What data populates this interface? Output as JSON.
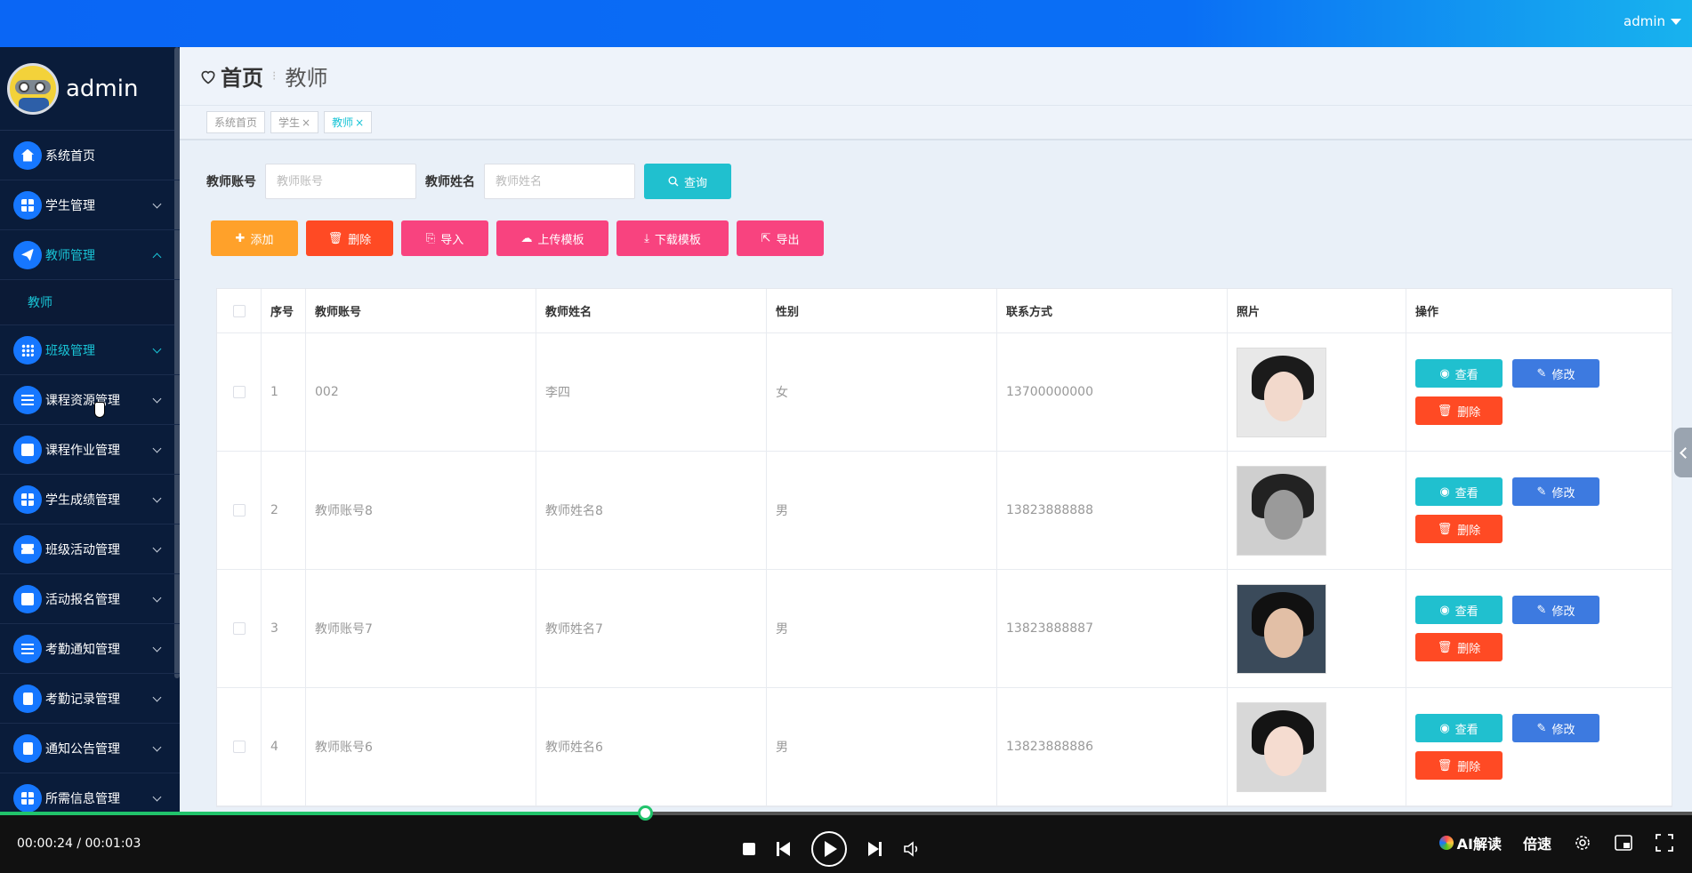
{
  "header": {
    "user": "admin"
  },
  "sidebar": {
    "username": "admin",
    "items": [
      {
        "label": "系统首页",
        "icon": "home-icon"
      },
      {
        "label": "学生管理",
        "icon": "grid-icon"
      },
      {
        "label": "教师管理",
        "icon": "paper-plane-icon"
      },
      {
        "label": "班级管理",
        "icon": "apps-icon"
      },
      {
        "label": "课程资源管理",
        "icon": "sliders-icon"
      },
      {
        "label": "课程作业管理",
        "icon": "book-icon"
      },
      {
        "label": "学生成绩管理",
        "icon": "grid-icon"
      },
      {
        "label": "班级活动管理",
        "icon": "ticket-icon"
      },
      {
        "label": "活动报名管理",
        "icon": "chart-icon"
      },
      {
        "label": "考勤通知管理",
        "icon": "list-icon"
      },
      {
        "label": "考勤记录管理",
        "icon": "clipboard-icon"
      },
      {
        "label": "通知公告管理",
        "icon": "check-icon"
      },
      {
        "label": "所需信息管理",
        "icon": "grid-icon"
      }
    ],
    "subitem": "教师"
  },
  "breadcrumb": {
    "home": "首页",
    "current": "教师"
  },
  "tabs": [
    {
      "label": "系统首页",
      "closable": ""
    },
    {
      "label": "学生",
      "closable": "×"
    },
    {
      "label": "教师",
      "closable": "×"
    }
  ],
  "search": {
    "account_label": "教师账号",
    "account_placeholder": "教师账号",
    "name_label": "教师姓名",
    "name_placeholder": "教师姓名",
    "query": "查询"
  },
  "actions": {
    "add": "添加",
    "delete": "删除",
    "import": "导入",
    "upload_template": "上传模板",
    "download_template": "下载模板",
    "export": "导出"
  },
  "colors": {
    "add": "#ffa12a",
    "delete": "#ff4a24",
    "import": "#f8437f",
    "upload": "#f8437f",
    "download": "#f8437f",
    "export": "#f8437f"
  },
  "table": {
    "headers": [
      "序号",
      "教师账号",
      "教师姓名",
      "性别",
      "联系方式",
      "照片",
      "操作"
    ],
    "rows": [
      {
        "index": "1",
        "account": "002",
        "name": "李四",
        "gender": "女",
        "phone": "13700000000"
      },
      {
        "index": "2",
        "account": "教师账号8",
        "name": "教师姓名8",
        "gender": "男",
        "phone": "13823888888"
      },
      {
        "index": "3",
        "account": "教师账号7",
        "name": "教师姓名7",
        "gender": "男",
        "phone": "13823888887"
      },
      {
        "index": "4",
        "account": "教师账号6",
        "name": "教师姓名6",
        "gender": "男",
        "phone": "13823888886"
      }
    ],
    "ops": {
      "view": "查看",
      "edit": "修改",
      "delete": "删除"
    }
  },
  "player": {
    "time": "00:00:24 / 00:01:03",
    "progress": 0.381,
    "ai": "AI解读",
    "speed": "倍速"
  }
}
